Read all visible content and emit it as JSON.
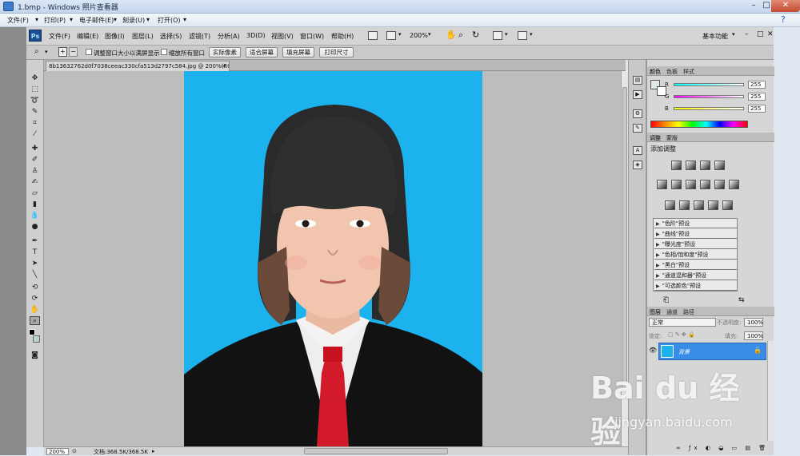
{
  "window": {
    "title": "1.bmp - Windows 照片查看器",
    "controls": [
      "minimize",
      "maximize",
      "close"
    ]
  },
  "viewer_menu": [
    "文件(F)",
    "打印(P)",
    "电子邮件(E)",
    "刻录(U)",
    "打开(O)"
  ],
  "ps": {
    "logo": "Ps",
    "menu": [
      "文件(F)",
      "编辑(E)",
      "图像(I)",
      "图层(L)",
      "选择(S)",
      "滤镜(T)",
      "分析(A)",
      "3D(D)",
      "视图(V)",
      "窗口(W)",
      "帮助(H)"
    ],
    "zoom_select": "200%",
    "workspace": "基本功能"
  },
  "options": {
    "check1": "调整窗口大小以满屏显示",
    "check2": "缩放所有窗口",
    "buttons": [
      "实际像素",
      "适合屏幕",
      "填充屏幕",
      "打印尺寸"
    ]
  },
  "document": {
    "tab": "8b13632762d0f7038ceeac330cfa513d2797c584.jpg @ 200%(RGB/8)",
    "background_color": "#1cb2ee"
  },
  "status": {
    "zoom": "200%",
    "doc": "文档:368.5K/368.5K"
  },
  "color_panel": {
    "tabs": [
      "颜色",
      "色板",
      "样式"
    ],
    "r": {
      "label": "R",
      "value": "255"
    },
    "g": {
      "label": "G",
      "value": "255"
    },
    "b": {
      "label": "B",
      "value": "255"
    }
  },
  "adjust_panel": {
    "tabs": [
      "调整",
      "蒙版"
    ],
    "title": "添加调整",
    "presets": [
      "\"色阶\"预设",
      "\"曲线\"预设",
      "\"曝光度\"预设",
      "\"色相/饱和度\"预设",
      "\"黑白\"预设",
      "\"通道混和器\"预设",
      "\"可选颜色\"预设"
    ]
  },
  "layers_panel": {
    "tabs": [
      "图层",
      "通道",
      "路径"
    ],
    "blend_mode": "正常",
    "opacity_label": "不透明度:",
    "opacity": "100%",
    "lock_label": "锁定:",
    "fill_label": "填充:",
    "fill": "100%",
    "layer_name": "背景"
  },
  "watermark": {
    "main": "Bai du 经验",
    "url": "jingyan.baidu.com"
  }
}
